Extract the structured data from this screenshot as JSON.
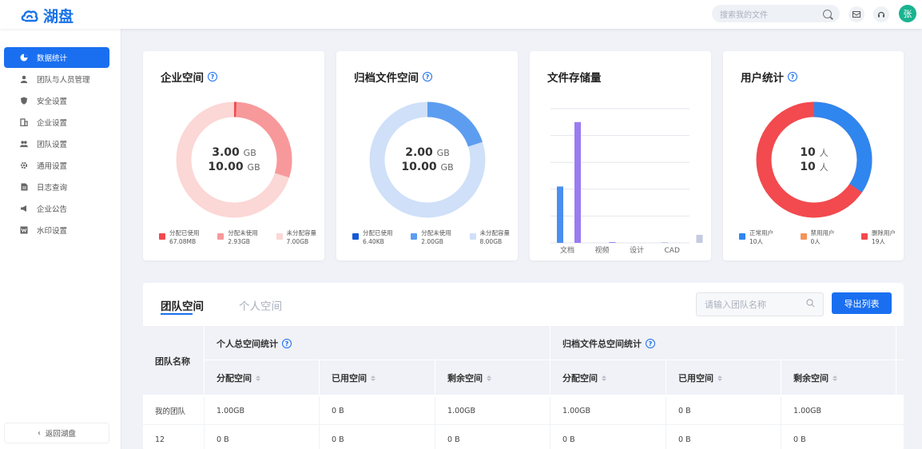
{
  "app": {
    "logo_text": "湖盘",
    "search_placeholder": "搜索我的文件",
    "avatar_initial": "张"
  },
  "sidebar": {
    "items": [
      {
        "label": "数据统计",
        "icon": "pie-chart-icon",
        "active": true
      },
      {
        "label": "团队与人员管理",
        "icon": "user-icon"
      },
      {
        "label": "安全设置",
        "icon": "shield-icon"
      },
      {
        "label": "企业设置",
        "icon": "building-icon"
      },
      {
        "label": "团队设置",
        "icon": "team-icon"
      },
      {
        "label": "通用设置",
        "icon": "gear-icon"
      },
      {
        "label": "日志查询",
        "icon": "document-icon"
      },
      {
        "label": "企业公告",
        "icon": "megaphone-icon"
      },
      {
        "label": "水印设置",
        "icon": "watermark-icon"
      }
    ],
    "back_label": "返回湖盘"
  },
  "cards": {
    "enterprise": {
      "title": "企业空间",
      "center_top": {
        "value": "3.00",
        "unit": "GB"
      },
      "center_bottom": {
        "value": "10.00",
        "unit": "GB"
      },
      "legend": [
        {
          "label": "分配已使用",
          "value": "67.08MB",
          "color": "#f0494d"
        },
        {
          "label": "分配未使用",
          "value": "2.93GB",
          "color": "#f7999b"
        },
        {
          "label": "未分配容量",
          "value": "7.00GB",
          "color": "#fbd7d5"
        }
      ]
    },
    "archive": {
      "title": "归档文件空间",
      "center_top": {
        "value": "2.00",
        "unit": "GB"
      },
      "center_bottom": {
        "value": "10.00",
        "unit": "GB"
      },
      "legend": [
        {
          "label": "分配已使用",
          "value": "6.40KB",
          "color": "#1558d6"
        },
        {
          "label": "分配未使用",
          "value": "2.00GB",
          "color": "#5d9df0"
        },
        {
          "label": "未分配容量",
          "value": "8.00GB",
          "color": "#cfe0f8"
        }
      ]
    },
    "storage": {
      "title": "文件存储量"
    },
    "users": {
      "title": "用户统计",
      "center_top": {
        "value": "10",
        "unit": "人"
      },
      "center_bottom": {
        "value": "10",
        "unit": "人"
      },
      "legend": [
        {
          "label": "正常用户",
          "value": "10人",
          "color": "#2f86ee"
        },
        {
          "label": "禁用用户",
          "value": "0人",
          "color": "#f5935c"
        },
        {
          "label": "删除用户",
          "value": "19人",
          "color": "#f24a4e"
        }
      ]
    }
  },
  "chart_data": {
    "type": "bar",
    "categories": [
      "文档",
      "视频",
      "设计",
      "CAD"
    ],
    "series": [
      {
        "color": "#4a8ff0",
        "values": [
          42,
          0,
          0,
          0
        ]
      },
      {
        "color": "#9b7cf0",
        "values": [
          90,
          0.5,
          0,
          0
        ]
      },
      {
        "color": "#c5cbe0",
        "values": [
          0,
          0,
          0.3,
          6
        ]
      }
    ],
    "ylim": [
      0,
      100
    ],
    "grid": true
  },
  "table": {
    "tabs": [
      "团队空间",
      "个人空间"
    ],
    "search_placeholder": "请输入团队名称",
    "export_label": "导出列表",
    "col_team": "团队名称",
    "group_personal": "个人总空间统计",
    "group_archive": "归档文件总空间统计",
    "subcols": [
      "分配空间",
      "已用空间",
      "剩余空间",
      "分配空间",
      "已用空间",
      "剩余空间"
    ],
    "rows": [
      {
        "name": "我的团队",
        "cells": [
          "1.00GB",
          "0 B",
          "1.00GB",
          "1.00GB",
          "0 B",
          "1.00GB"
        ]
      },
      {
        "name": "12",
        "cells": [
          "0 B",
          "0 B",
          "0 B",
          "0 B",
          "0 B",
          "0 B"
        ]
      }
    ]
  }
}
